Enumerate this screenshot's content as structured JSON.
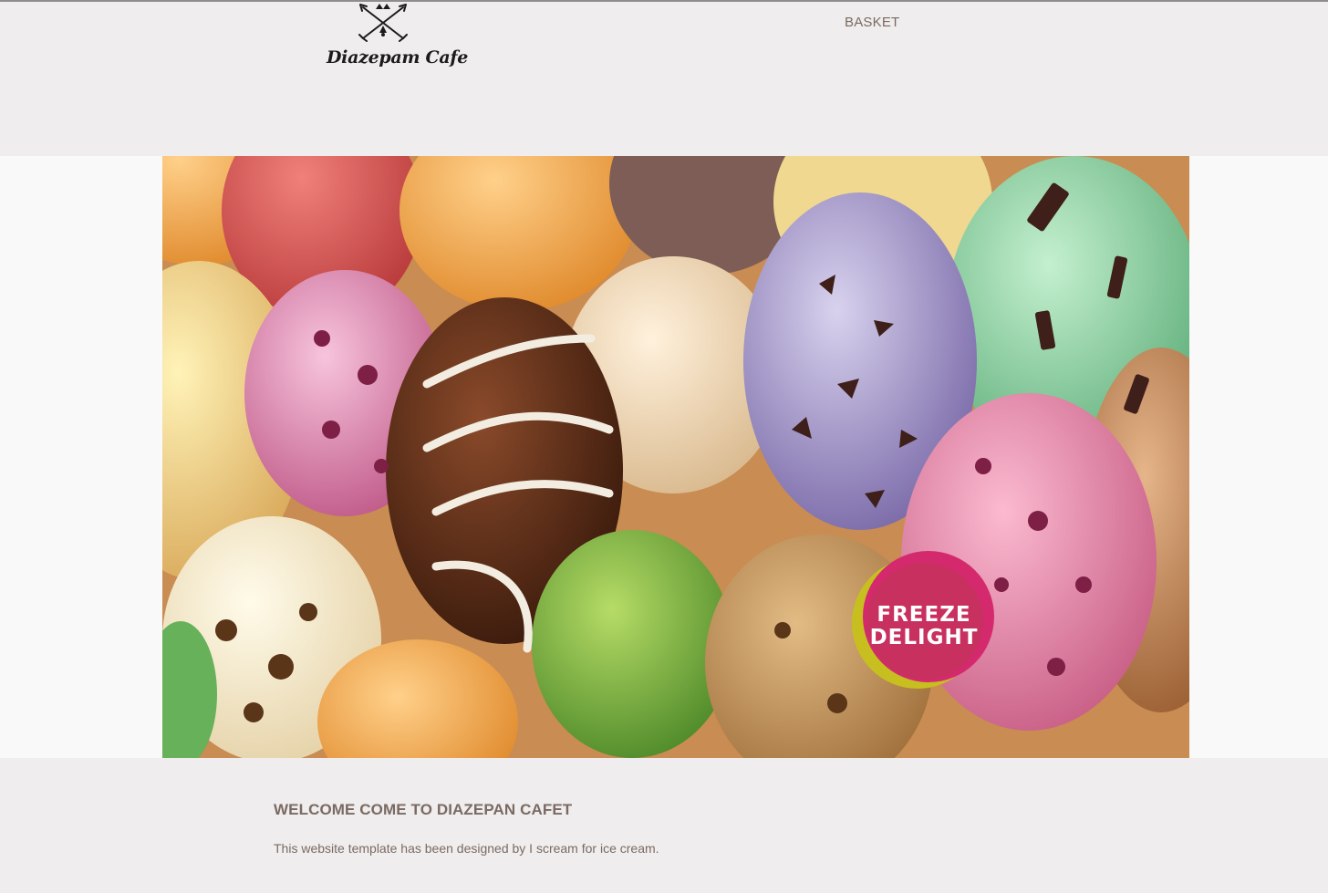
{
  "brand": {
    "name": "Diazepam Cafe",
    "emblem_icon": "crossed-arrows-icon"
  },
  "nav": {
    "basket_label": "BASKET"
  },
  "hero": {
    "image_subject": "ice-cream-scoops-banner",
    "badge": {
      "line1": "FREEZE",
      "line2": "DELIGHT"
    }
  },
  "content": {
    "welcome_title": "WELCOME COME TO DIAZEPAN CAFET",
    "intro_text": "This website template has been designed by I scream for ice cream."
  },
  "colors": {
    "page_background": "#efeded",
    "hero_band": "#f9f9f9",
    "text": "#7a6a63",
    "badge_pink": "#c8305f",
    "badge_ring": "#c7bf1f"
  }
}
